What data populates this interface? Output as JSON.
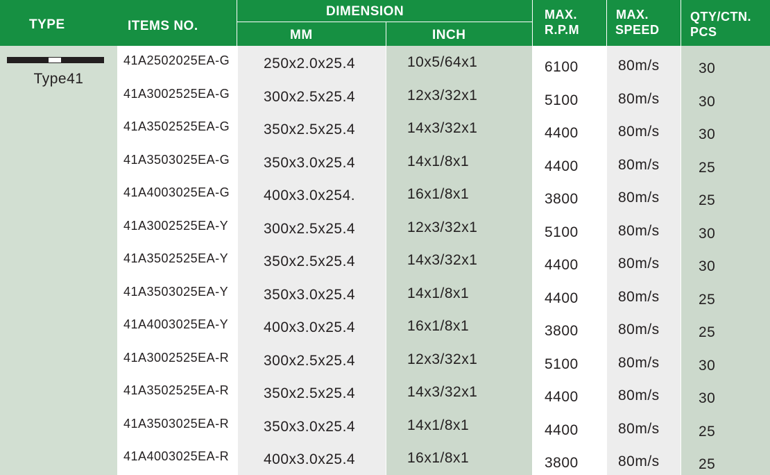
{
  "header": {
    "type": "TYPE",
    "items_no": "ITEMS NO.",
    "dimension": "DIMENSION",
    "mm": "MM",
    "inch": "INCH",
    "max_rpm_1": "MAX.",
    "max_rpm_2": "R.P.M",
    "max_speed_1": "MAX.",
    "max_speed_2": "SPEED",
    "qty_1": "QTY/CTN.",
    "qty_2": "PCS"
  },
  "type_label": "Type41",
  "colors": {
    "header_green": "#169042",
    "type_column": "#d2dfd2",
    "mm_column": "#ededed",
    "inch_column": "#ccd9cc"
  },
  "rows": [
    {
      "item": "41A2502025EA-G",
      "mm": "250x2.0x25.4",
      "inch": "10x5/64x1",
      "rpm": "6100",
      "speed": "80m/s",
      "qty": "30"
    },
    {
      "item": "41A3002525EA-G",
      "mm": "300x2.5x25.4",
      "inch": "12x3/32x1",
      "rpm": "5100",
      "speed": "80m/s",
      "qty": "30"
    },
    {
      "item": "41A3502525EA-G",
      "mm": "350x2.5x25.4",
      "inch": "14x3/32x1",
      "rpm": "4400",
      "speed": "80m/s",
      "qty": "30"
    },
    {
      "item": "41A3503025EA-G",
      "mm": "350x3.0x25.4",
      "inch": "14x1/8x1",
      "rpm": "4400",
      "speed": "80m/s",
      "qty": "25"
    },
    {
      "item": "41A4003025EA-G",
      "mm": "400x3.0x254.",
      "inch": "16x1/8x1",
      "rpm": "3800",
      "speed": "80m/s",
      "qty": "25"
    },
    {
      "item": "41A3002525EA-Y",
      "mm": "300x2.5x25.4",
      "inch": "12x3/32x1",
      "rpm": "5100",
      "speed": "80m/s",
      "qty": "30"
    },
    {
      "item": "41A3502525EA-Y",
      "mm": "350x2.5x25.4",
      "inch": "14x3/32x1",
      "rpm": "4400",
      "speed": "80m/s",
      "qty": "30"
    },
    {
      "item": "41A3503025EA-Y",
      "mm": "350x3.0x25.4",
      "inch": "14x1/8x1",
      "rpm": "4400",
      "speed": "80m/s",
      "qty": "25"
    },
    {
      "item": "41A4003025EA-Y",
      "mm": "400x3.0x25.4",
      "inch": "16x1/8x1",
      "rpm": "3800",
      "speed": "80m/s",
      "qty": "25"
    },
    {
      "item": "41A3002525EA-R",
      "mm": "300x2.5x25.4",
      "inch": "12x3/32x1",
      "rpm": "5100",
      "speed": "80m/s",
      "qty": "30"
    },
    {
      "item": "41A3502525EA-R",
      "mm": "350x2.5x25.4",
      "inch": "14x3/32x1",
      "rpm": "4400",
      "speed": "80m/s",
      "qty": "30"
    },
    {
      "item": "41A3503025EA-R",
      "mm": "350x3.0x25.4",
      "inch": "14x1/8x1",
      "rpm": "4400",
      "speed": "80m/s",
      "qty": "25"
    },
    {
      "item": "41A4003025EA-R",
      "mm": "400x3.0x25.4",
      "inch": "16x1/8x1",
      "rpm": "3800",
      "speed": "80m/s",
      "qty": "25"
    }
  ]
}
